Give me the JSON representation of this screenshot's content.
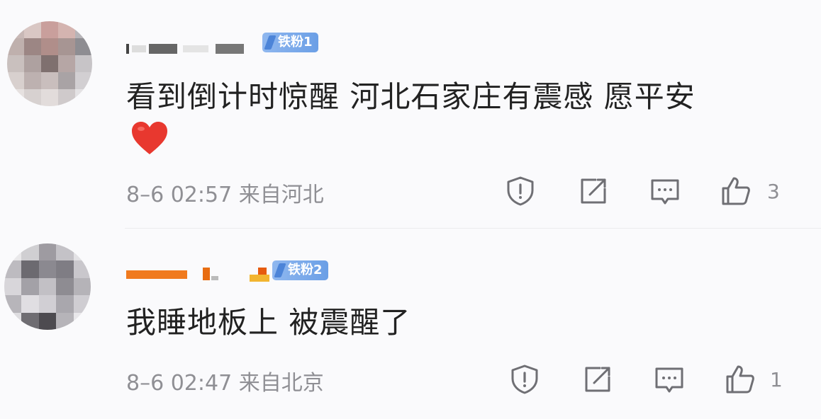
{
  "comments": [
    {
      "badge": "铁粉1",
      "text": "看到倒计时惊醒 河北石家庄有震感 愿平安",
      "emoji": "heart",
      "meta": "8–6 02:57 来自河北",
      "likes": "3",
      "avatar": [
        "#c8b8b6",
        "#d9c7c4",
        "#c99f9c",
        "#d4b4b0",
        "#b7b4b8",
        "#bfb0ad",
        "#9c8684",
        "#b08e8a",
        "#a79593",
        "#8e8d92",
        "#c9c0be",
        "#aea1a0",
        "#7f706f",
        "#b6a6a5",
        "#c7c4c7",
        "#d8d0ce",
        "#bdb1b0",
        "#c9bebd",
        "#a9a3a5",
        "#d2cfd2",
        "#e6e1e0",
        "#d7d1d0",
        "#e2dcdb",
        "#cfcacb",
        "#e4e2e4"
      ]
    },
    {
      "badge": "铁粉2",
      "text": "我睡地板上 被震醒了",
      "meta": "8–6 02:47 来自北京",
      "likes": "1",
      "avatar": [
        "#e9e8ea",
        "#d0cfd2",
        "#9e9ba1",
        "#c4c2c7",
        "#e3e2e5",
        "#bdbbc0",
        "#6c6a70",
        "#8b8990",
        "#7f7d84",
        "#c9c7cc",
        "#d8d6da",
        "#a3a1a7",
        "#c2c0c5",
        "#8e8c92",
        "#b5b3b8",
        "#b7b5ba",
        "#e0dee2",
        "#d1cfd4",
        "#a9a7ad",
        "#cfcdd2",
        "#dedde0",
        "#6f6d72",
        "#4d4b50",
        "#b6b4b9",
        "#e8e7ea"
      ]
    }
  ],
  "icons": {
    "report": "report-shield-icon",
    "repost": "repost-icon",
    "reply": "reply-icon",
    "like": "thumbs-up-icon",
    "emoji": "red-heart-icon"
  },
  "colors": {
    "text": "#222222",
    "meta": "#8f8f94",
    "badge": "#6b9fe6",
    "heart": "#e8382f"
  }
}
